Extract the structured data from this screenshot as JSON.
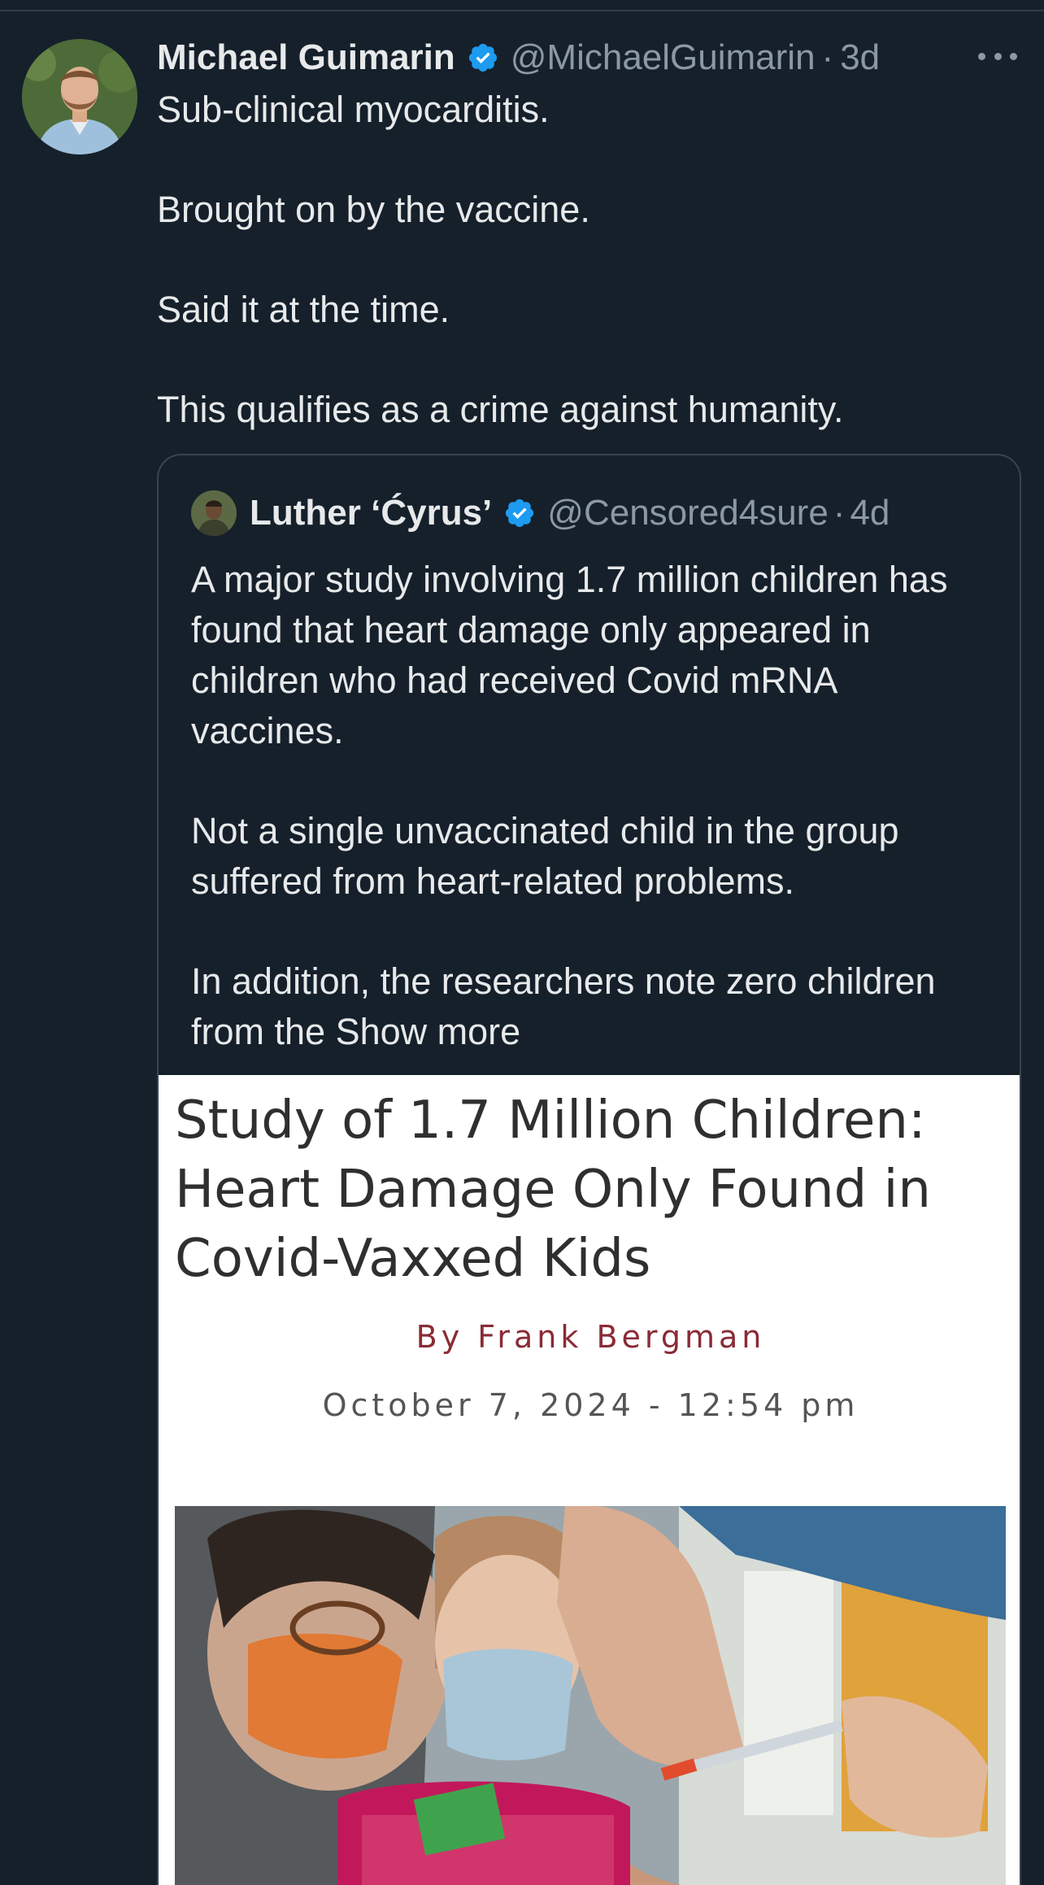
{
  "tweet": {
    "author": {
      "display_name": "Michael Guimarin",
      "handle": "@MichaelGuimarin",
      "time": "3d",
      "verified": true
    },
    "separator": "·",
    "lines": [
      "Sub-clinical myocarditis.",
      "Brought on by the vaccine.",
      "Said it at the time.",
      "This qualifies as a crime against humanity."
    ],
    "more_icon": "more-horizontal-icon"
  },
  "quoted_tweet": {
    "author": {
      "display_name": "Luther ‘Ćyrus’",
      "handle": "@Censored4sure",
      "time": "4d",
      "verified": true
    },
    "separator": "·",
    "paragraphs": [
      "A major study involving 1.7 million children has found that heart damage only appeared in children who had received Covid mRNA vaccines.",
      "Not a single unvaccinated child in the group suffered from heart-related problems.",
      "In addition, the researchers note zero children from the"
    ],
    "show_more_label": "Show more"
  },
  "article_card": {
    "title": "Study of 1.7 Million Children: Heart Damage Only Found in Covid-Vaxxed Kids",
    "author": "By Frank Bergman",
    "date": "October 7, 2024 - 12:54 pm"
  },
  "colors": {
    "background": "#15202b",
    "text": "#e7e9ea",
    "secondary_text": "#8b98a5",
    "verified_badge": "#1d9bf0",
    "card_border": "#38444d",
    "article_author": "#8a2b36"
  }
}
